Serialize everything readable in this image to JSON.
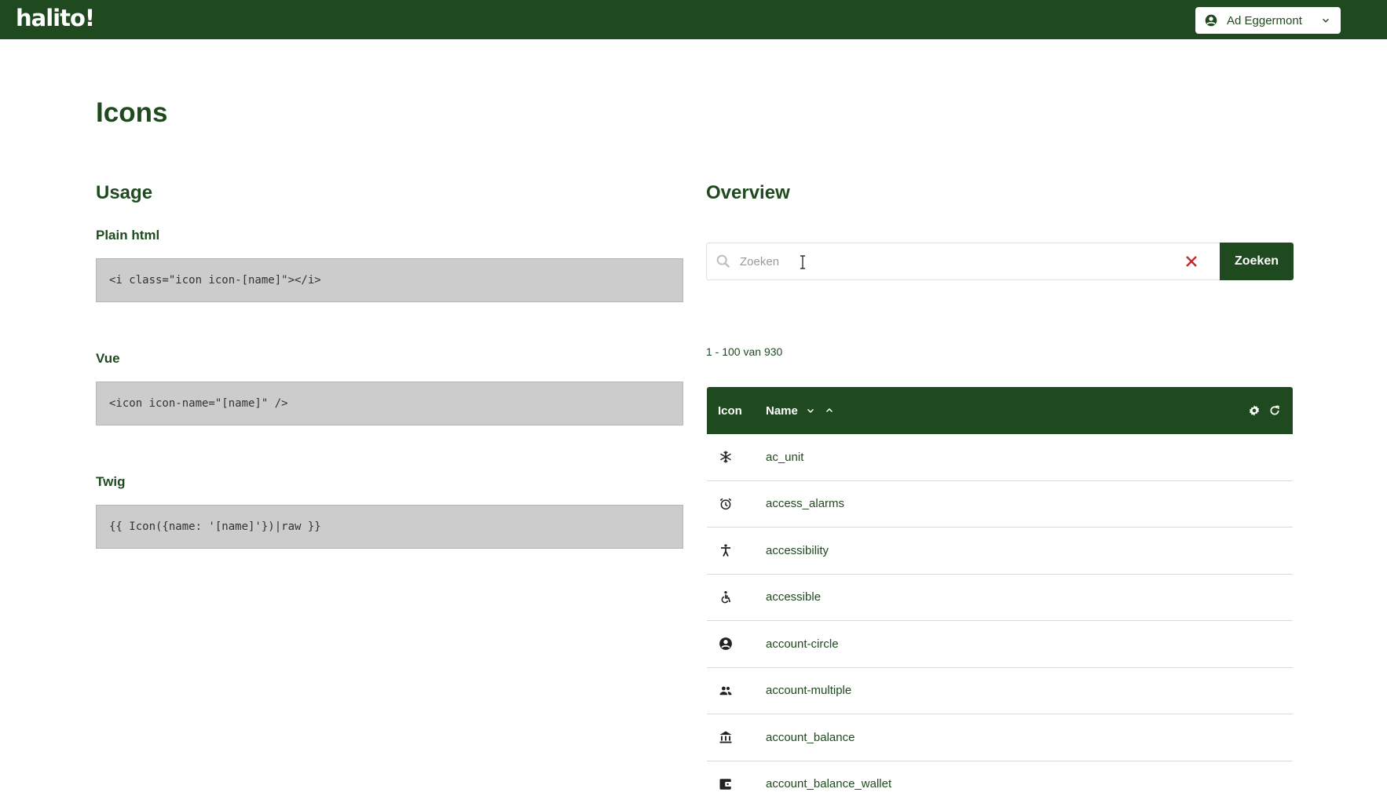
{
  "header": {
    "logo": "halito!",
    "user_name": "Ad Eggermont",
    "user_icon": "account-circle-icon",
    "user_menu_icon": "chevron-down-icon"
  },
  "page": {
    "title": "Icons"
  },
  "usage": {
    "title": "Usage",
    "plain_html_label": "Plain html",
    "plain_html_code": "<i class=\"icon icon-[name]\"></i>",
    "vue_label": "Vue",
    "vue_code": "<icon icon-name=\"[name]\" />",
    "twig_label": "Twig",
    "twig_code": "{{ Icon({name: '[name]'})|raw }}"
  },
  "overview": {
    "title": "Overview",
    "search": {
      "placeholder": "Zoeken",
      "value": "",
      "button_label": "Zoeken"
    },
    "count_text": "1 - 100 van 930",
    "table": {
      "col_icon": "Icon",
      "col_name": "Name",
      "rows": [
        {
          "icon": "ac-unit-icon",
          "name": "ac_unit"
        },
        {
          "icon": "alarm-icon",
          "name": "access_alarms"
        },
        {
          "icon": "accessibility-icon",
          "name": "accessibility"
        },
        {
          "icon": "accessible-icon",
          "name": "accessible"
        },
        {
          "icon": "account-circle-icon",
          "name": "account-circle"
        },
        {
          "icon": "account-multiple-icon",
          "name": "account-multiple"
        },
        {
          "icon": "bank-icon",
          "name": "account_balance"
        },
        {
          "icon": "wallet-icon",
          "name": "account_balance_wallet"
        }
      ]
    }
  },
  "colors": {
    "brand": "#1f4a1f",
    "code_bg": "#cccccc",
    "clear_icon": "#c62828"
  }
}
